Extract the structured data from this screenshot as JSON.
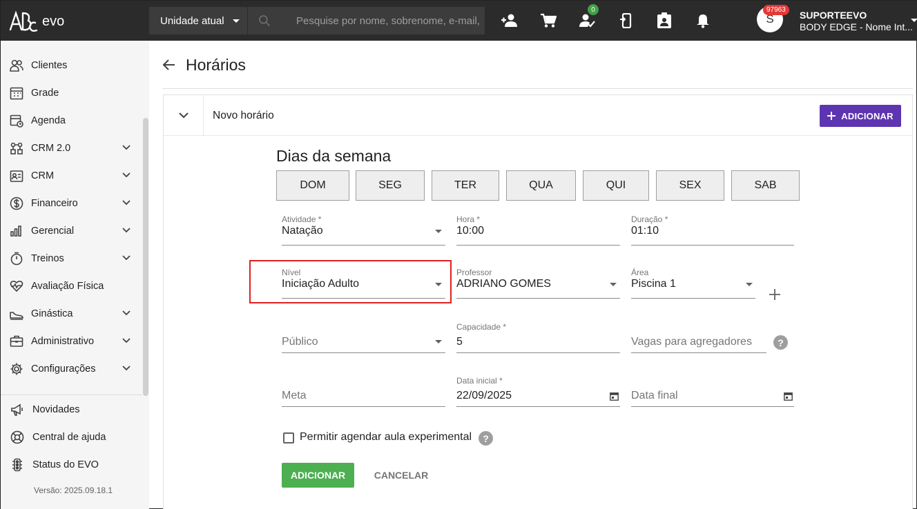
{
  "topbar": {
    "logo_text": "evo",
    "unit_select": "Unidade atual",
    "search_placeholder": "Pesquise por nome, sobrenome, e-mail, C",
    "tasks_badge": "0",
    "notifications_badge": "97963",
    "avatar_initial": "S",
    "user_name": "SUPORTEEVO",
    "user_company": "BODY EDGE - Nome Int..."
  },
  "sidebar": {
    "items": [
      {
        "label": "Clientes",
        "icon": "clients-icon",
        "expandable": false
      },
      {
        "label": "Grade",
        "icon": "grid-calendar-icon",
        "expandable": false
      },
      {
        "label": "Agenda",
        "icon": "calendar-clock-icon",
        "expandable": false
      },
      {
        "label": "CRM 2.0",
        "icon": "crm-flow-icon",
        "expandable": true
      },
      {
        "label": "CRM",
        "icon": "contact-card-icon",
        "expandable": true
      },
      {
        "label": "Financeiro",
        "icon": "dollar-icon",
        "expandable": true
      },
      {
        "label": "Gerencial",
        "icon": "bar-chart-icon",
        "expandable": true
      },
      {
        "label": "Treinos",
        "icon": "stopwatch-icon",
        "expandable": true
      },
      {
        "label": "Avaliação Física",
        "icon": "heartbeat-icon",
        "expandable": false
      },
      {
        "label": "Ginástica",
        "icon": "sneaker-icon",
        "expandable": true
      },
      {
        "label": "Administrativo",
        "icon": "briefcase-icon",
        "expandable": true
      },
      {
        "label": "Configurações",
        "icon": "gear-icon",
        "expandable": true
      }
    ],
    "bottom_items": [
      {
        "label": "Novidades",
        "icon": "megaphone-icon"
      },
      {
        "label": "Central de ajuda",
        "icon": "lifebuoy-icon"
      },
      {
        "label": "Status do EVO",
        "icon": "traffic-light-icon"
      }
    ],
    "version": "Versão: 2025.09.18.1"
  },
  "page": {
    "title": "Horários"
  },
  "panel": {
    "title": "Novo horário",
    "add_button": "ADICIONAR"
  },
  "form": {
    "days_title": "Dias da semana",
    "days": [
      "DOM",
      "SEG",
      "TER",
      "QUA",
      "QUI",
      "SEX",
      "SAB"
    ],
    "atividade": {
      "label": "Atividade *",
      "value": "Natação"
    },
    "hora": {
      "label": "Hora *",
      "value": "10:00"
    },
    "duracao": {
      "label": "Duração *",
      "value": "01:10"
    },
    "nivel": {
      "label": "Nível",
      "value": "Iniciação Adulto"
    },
    "professor": {
      "label": "Professor",
      "value": "ADRIANO GOMES"
    },
    "area": {
      "label": "Área",
      "value": "Piscina 1"
    },
    "publico": {
      "placeholder": "Público"
    },
    "capacidade": {
      "label": "Capacidade *",
      "value": "5"
    },
    "vagas": {
      "placeholder": "Vagas para agregadores"
    },
    "meta": {
      "placeholder": "Meta"
    },
    "data_inicial": {
      "label": "Data inicial *",
      "value": "22/09/2025"
    },
    "data_final": {
      "placeholder": "Data final"
    },
    "experimental_label": "Permitir agendar aula experimental",
    "help_glyph": "?",
    "submit": "ADICIONAR",
    "cancel": "CANCELAR"
  },
  "colors": {
    "topbar": "#2b2b2b",
    "accent_purple": "#5e35b1",
    "success_green": "#4caf50",
    "highlight_red": "#e02020"
  }
}
